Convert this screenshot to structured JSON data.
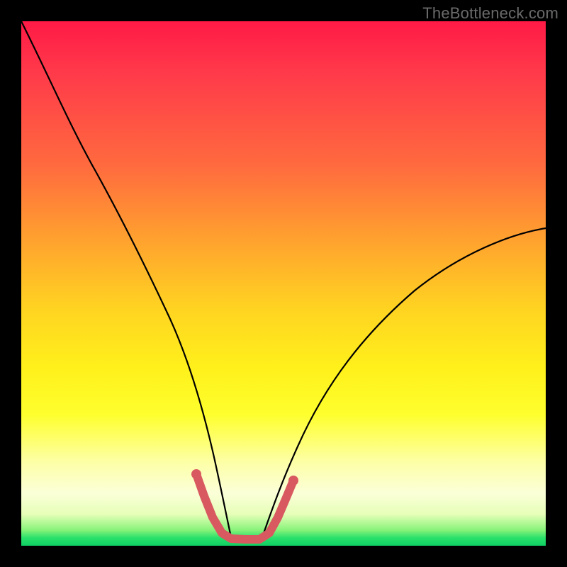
{
  "watermark": "TheBottleneck.com",
  "colors": {
    "frame": "#000000",
    "curve": "#000000",
    "accent_stroke": "#d85a60",
    "gradient_stops": [
      "#ff1a46",
      "#ff6c3e",
      "#ffd421",
      "#fdffa6",
      "#29e06a"
    ]
  },
  "chart_data": {
    "type": "line",
    "title": "",
    "xlabel": "",
    "ylabel": "",
    "xlim": [
      0,
      100
    ],
    "ylim": [
      0,
      100
    ],
    "grid": false,
    "legend": null,
    "series": [
      {
        "name": "bottleneck-curve",
        "x": [
          0,
          3,
          6,
          10,
          14,
          18,
          22,
          26,
          30,
          33,
          35,
          37,
          39,
          41,
          43,
          46,
          50,
          55,
          60,
          66,
          74,
          82,
          90,
          100
        ],
        "values": [
          100,
          91,
          82,
          72,
          62,
          52,
          43,
          34,
          24,
          15,
          10,
          5,
          2,
          1,
          1,
          2,
          6,
          12,
          19,
          26,
          35,
          43,
          50,
          58
        ]
      }
    ],
    "accent_segment": {
      "name": "valley-highlight",
      "x": [
        33,
        35,
        37,
        39,
        41,
        43,
        46
      ],
      "values": [
        15,
        10,
        5,
        2,
        1,
        2,
        6
      ]
    }
  }
}
